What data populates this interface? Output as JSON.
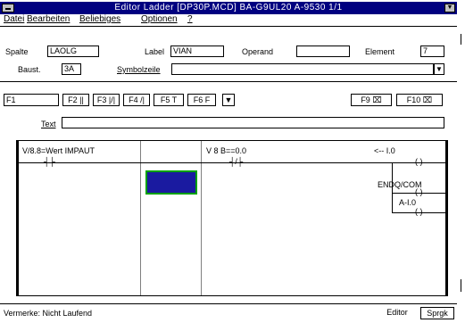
{
  "window": {
    "title": "Editor Ladder  [DP30P.MCD] BA-G9UL20 A-9530 1/1",
    "minimize_glyph": "▼"
  },
  "menu": [
    "Datei",
    "Bearbeiten",
    "Beliebiges",
    "Optionen",
    "?"
  ],
  "fields": {
    "spalte_label": "Spalte",
    "spalte_value": "LAOLG",
    "label_label": "Label",
    "label_value": "VIAN",
    "operand_label": "Operand",
    "operand_value": "",
    "element_label": "Element",
    "element_value": "7",
    "bausteine_label": "Baust.",
    "bausteine_value": "3A",
    "symbol_label": "Symbolzeile",
    "symbol_value": "",
    "text_label": "Text",
    "text_value": ""
  },
  "fkeys": [
    {
      "label": "F1"
    },
    {
      "label": "F2  ||"
    },
    {
      "label": "F3  |/|"
    },
    {
      "label": "F4  /|"
    },
    {
      "label": "F5   T"
    },
    {
      "label": "F6   F"
    }
  ],
  "fkeys_right": [
    {
      "label": "F9  ⌧"
    },
    {
      "label": "F10 ⌧"
    }
  ],
  "diagram": {
    "rung1_contact1": "V/8.8=Wert IMPAUT",
    "rung1_contact2": "V 8 B==0.0",
    "coil1": "<-- I.0",
    "coil2": "ENDQ/COM",
    "coil3": "--( )--",
    "coil4": "A-I.0"
  },
  "status": {
    "text": "Vermerke: Nicht Laufend",
    "mode": "Editor",
    "sprache": "Sprgk"
  },
  "colors": {
    "selection": "#1a1aa0",
    "selection_border": "#00a000",
    "titlebar": "#000080"
  }
}
